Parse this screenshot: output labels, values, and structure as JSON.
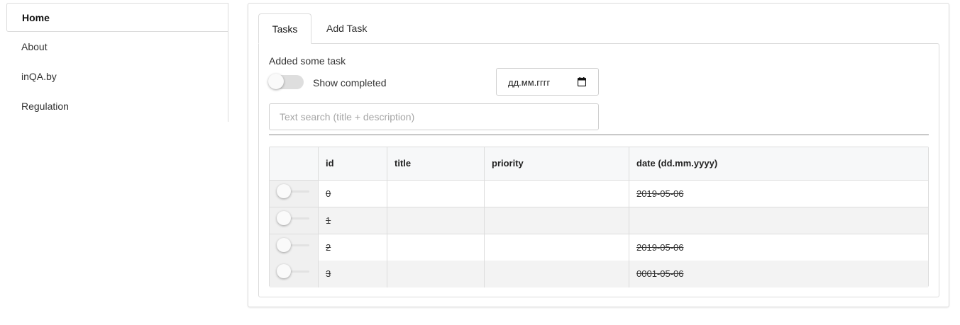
{
  "sidebar": {
    "items": [
      {
        "label": "Home",
        "active": true
      },
      {
        "label": "About",
        "active": false
      },
      {
        "label": "inQA.by",
        "active": false
      },
      {
        "label": "Regulation",
        "active": false
      }
    ]
  },
  "tabs": [
    {
      "label": "Tasks",
      "active": true
    },
    {
      "label": "Add Task",
      "active": false
    }
  ],
  "status_message": "Added some task",
  "show_completed": {
    "label": "Show completed",
    "checked": false
  },
  "date_filter": {
    "placeholder": "дд.мм.гггг",
    "icon": "calendar-icon"
  },
  "search": {
    "placeholder": "Text search (title + description)",
    "value": ""
  },
  "table": {
    "columns": [
      "id",
      "title",
      "priority",
      "date (dd.mm.yyyy)"
    ],
    "rows": [
      {
        "id": "0",
        "title": "",
        "priority": "",
        "date": "2019-05-06",
        "completed": false
      },
      {
        "id": "1",
        "title": "",
        "priority": "",
        "date": "",
        "completed": false
      },
      {
        "id": "2",
        "title": "",
        "priority": "",
        "date": "2019-05-06",
        "completed": false
      },
      {
        "id": "3",
        "title": "",
        "priority": "",
        "date": "0001-05-06",
        "completed": false
      }
    ]
  },
  "colors": {
    "border": "#dcdcdc",
    "header_bg": "#f7f8f9",
    "stripe_bg": "#f3f3f3",
    "toggle_track": "#dedede"
  }
}
